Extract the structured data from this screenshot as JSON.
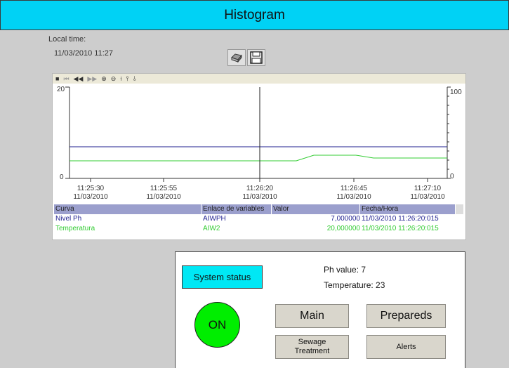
{
  "header": {
    "title": "Histogram"
  },
  "local_time": {
    "label": "Local time:",
    "value": "11/03/2010 11:27"
  },
  "toolbar": {
    "icons": [
      "printer-icon",
      "save-disk-icon"
    ]
  },
  "trend": {
    "toolbar_icons": [
      "stop-icon",
      "first-icon",
      "rewind-icon",
      "forward-icon",
      "zoom-in-icon",
      "zoom-out-icon",
      "ruler-icon",
      "ruler-up-icon",
      "ruler-down-icon"
    ],
    "left_axis": {
      "min": "0",
      "max": "20"
    },
    "right_axis": {
      "min": "0",
      "max": "100"
    },
    "time_ticks": [
      {
        "time": "11:25:30",
        "date": "11/03/2010"
      },
      {
        "time": "11:25:55",
        "date": "11/03/2010"
      },
      {
        "time": "11:26:20",
        "date": "11/03/2010"
      },
      {
        "time": "11:26:45",
        "date": "11/03/2010"
      },
      {
        "time": "11:27:10",
        "date": "11/03/2010"
      }
    ],
    "colors": {
      "ph": "#1f1f8f",
      "temp": "#33cc33",
      "cursor": "#222222"
    }
  },
  "table": {
    "headers": {
      "curve": "Curva",
      "link": "Enlace de variables",
      "value": "Valor",
      "datetime": "Fecha/Hora"
    },
    "rows": [
      {
        "curve": "Nivel Ph",
        "link": "AIWPH",
        "value": "7,000000",
        "datetime": "11/03/2010 11:26:20:015",
        "color": "#1f1f8f"
      },
      {
        "curve": "Temperatura",
        "link": "AIW2",
        "value": "20,000000",
        "datetime": "11/03/2010 11:26:20:015",
        "color": "#33cc33"
      }
    ]
  },
  "panel": {
    "system_status": "System status",
    "ph_label": "Ph value:",
    "ph_value": "7",
    "temp_label": "Temperature:",
    "temp_value": "23",
    "on_label": "ON",
    "buttons": {
      "main": "Main",
      "prepareds": "Prepareds",
      "sewage_line1": "Sewage",
      "sewage_line2": "Treatment",
      "alerts": "Alerts"
    }
  }
}
